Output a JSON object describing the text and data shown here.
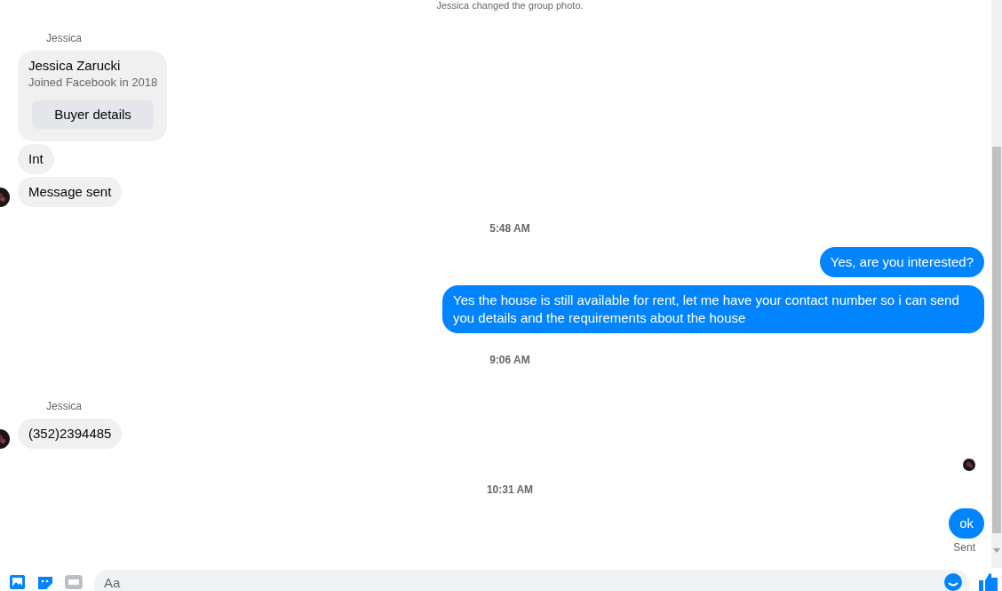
{
  "thread": [
    {
      "kind": "notice",
      "text": "Jessica changed the group photo."
    },
    {
      "kind": "sender",
      "text": "Jessica"
    },
    {
      "kind": "card",
      "name": "Jessica Zarucki",
      "subtitle": "Joined Facebook in 2018",
      "button": "Buyer details"
    },
    {
      "kind": "incoming",
      "text": "Int",
      "avatar": false
    },
    {
      "kind": "incoming",
      "text": "Message sent",
      "avatar": true
    },
    {
      "kind": "time",
      "text": "5:48 AM"
    },
    {
      "kind": "outgoing",
      "text": "Yes, are you interested?"
    },
    {
      "kind": "outgoing",
      "text": "Yes the house is still available for rent, let me have your contact number so i can send you details and the requirements about the house"
    },
    {
      "kind": "time",
      "text": "9:06 AM"
    },
    {
      "kind": "sender",
      "text": "Jessica"
    },
    {
      "kind": "incoming",
      "text": "(352)2394485",
      "avatar": true
    },
    {
      "kind": "read_receipt"
    },
    {
      "kind": "time",
      "text": "10:31 AM"
    },
    {
      "kind": "outgoing",
      "text": "ok"
    },
    {
      "kind": "status",
      "text": "Sent"
    }
  ],
  "composer": {
    "placeholder": "Aa"
  }
}
